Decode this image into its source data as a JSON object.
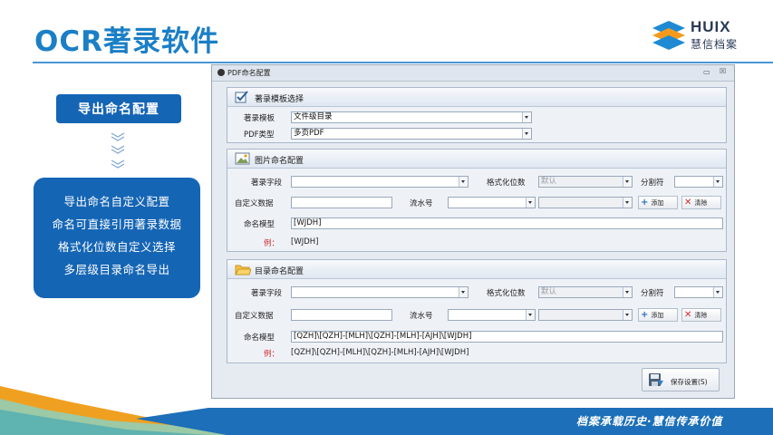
{
  "slide": {
    "title": "OCR著录软件",
    "logo_name": "HUIX",
    "logo_sub": "慧信档案",
    "section_label": "导出命名配置",
    "features": [
      "导出命名自定义配置",
      "命名可直接引用著录数据",
      "格式化位数自定义选择",
      "多层级目录命名导出"
    ],
    "slogan": "档案承载历史·慧信传承价值"
  },
  "dialog": {
    "title": "PDF命名配置",
    "minimize": "▭",
    "close": "☒",
    "template_group": {
      "title": "著录模板选择",
      "template_label": "著录模板",
      "template_value": "文件级目录",
      "pdf_type_label": "PDF类型",
      "pdf_type_value": "多页PDF"
    },
    "image_group": {
      "title": "图片命名配置",
      "field_label": "著录字段",
      "field_value": "",
      "format_label": "格式化位数",
      "format_value": "默认",
      "separator_label": "分割符",
      "separator_value": "",
      "custom_label": "自定义数据",
      "custom_value": "",
      "serial_label": "流水号",
      "serial_value": "",
      "serial_extra_value": "",
      "add_label": "添加",
      "clear_label": "清除",
      "model_label": "命名模型",
      "model_value": "[WJDH]",
      "example_label": "例：",
      "example_value": "[WJDH]"
    },
    "dir_group": {
      "title": "目录命名配置",
      "field_label": "著录字段",
      "field_value": "",
      "format_label": "格式化位数",
      "format_value": "默认",
      "separator_label": "分割符",
      "separator_value": "",
      "custom_label": "自定义数据",
      "custom_value": "",
      "serial_label": "流水号",
      "serial_value": "",
      "serial_extra_value": "",
      "add_label": "添加",
      "clear_label": "清除",
      "model_label": "命名模型",
      "model_value": "[QZH]\\[QZH]-[MLH]\\[QZH]-[MLH]-[AJH]\\[WJDH]",
      "example_label": "例：",
      "example_value": "[QZH]\\[QZH]-[MLH]\\[QZH]-[MLH]-[AJH]\\[WJDH]"
    },
    "save_label": "保存设置(S)"
  },
  "colors": {
    "brand_blue": "#1565b5",
    "title_blue": "#1b7fc6",
    "example_red": "#d0262d",
    "band_orange": "#f0a020"
  },
  "icons": [
    "check-icon",
    "image-icon",
    "folder-icon",
    "plus-icon",
    "delete-x-icon",
    "save-disk-icon",
    "chevron-down-icon",
    "huix-logo"
  ]
}
